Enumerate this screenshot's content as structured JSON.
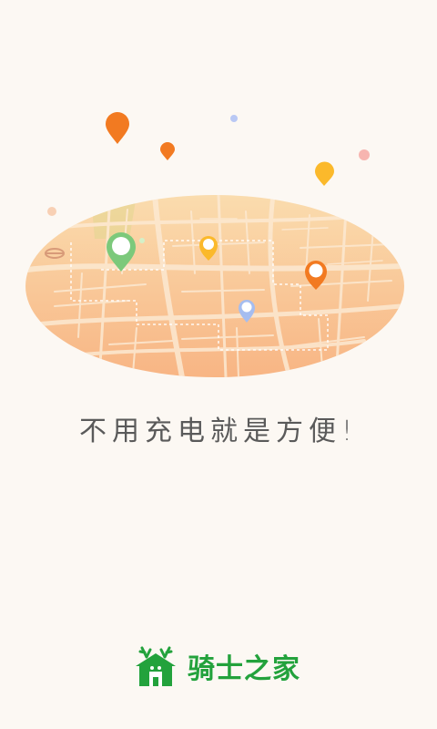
{
  "tagline": "不用充电就是方便!",
  "brand": {
    "name": "骑士之家",
    "logo_icon": "knight-house-logo-icon",
    "color": "#23a23c"
  },
  "colors": {
    "background": "#fcf8f3",
    "map_gradient_top": "#f9d6a4",
    "map_gradient_bottom": "#f7b27f",
    "pin_green": "#7cc97b",
    "pin_yellow": "#fbb92b",
    "pin_orange": "#f27a21",
    "pin_blue": "#a5bdf0"
  }
}
